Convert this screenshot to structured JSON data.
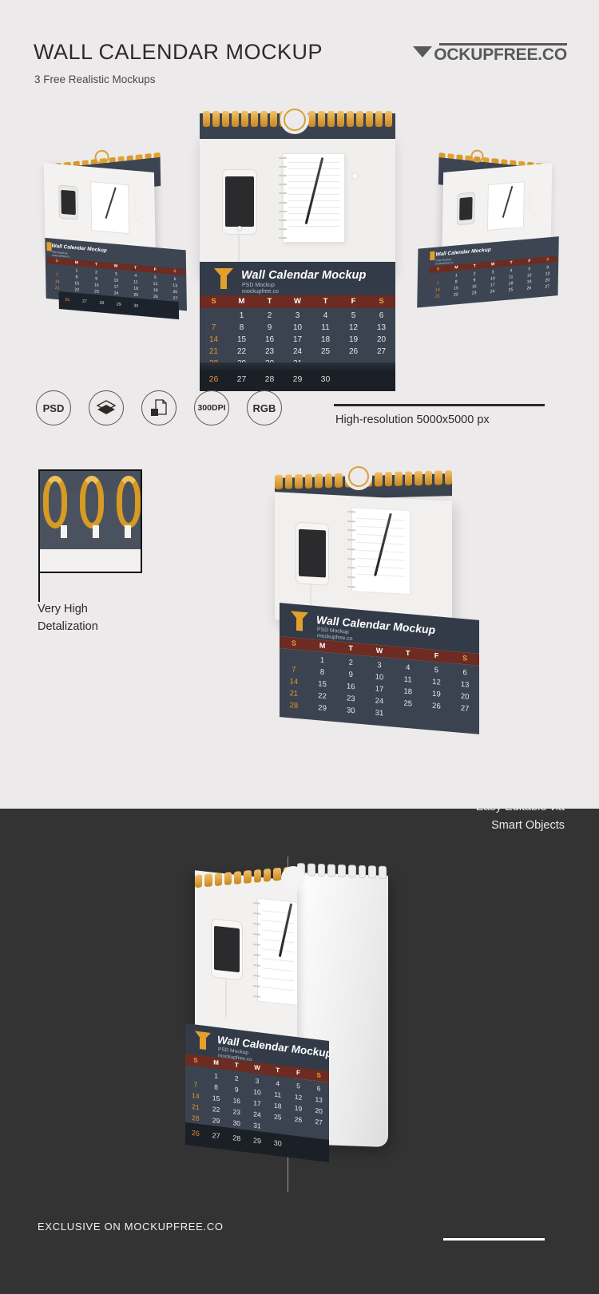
{
  "header": {
    "title": "WALL CALENDAR MOCKUP",
    "subtitle": "3 Free Realistic Mockups",
    "brand_mark": "M",
    "brand_text": "OCKUPFREE",
    "brand_suffix": ".CO"
  },
  "badges": [
    {
      "id": "psd",
      "label": "PSD",
      "icon": "psd-badge"
    },
    {
      "id": "layers",
      "label": "",
      "icon": "layers-icon"
    },
    {
      "id": "smart-object",
      "label": "",
      "icon": "smart-object-icon"
    },
    {
      "id": "dpi",
      "label_top": "300",
      "label_bottom": "DPI",
      "icon": "dpi-badge"
    },
    {
      "id": "rgb",
      "label": "RGB",
      "icon": "rgb-badge"
    }
  ],
  "resolution": {
    "text": "High-resolution 5000x5000 px"
  },
  "detail": {
    "caption_line1": "Very High",
    "caption_line2": "Detalization"
  },
  "calendar": {
    "brand_mark": "M",
    "title": "Wall Calendar Mockup",
    "sub1": "PSD Mockup",
    "sub2": "mockupfree.co",
    "weekdays": [
      "S",
      "M",
      "T",
      "W",
      "T",
      "F",
      "S"
    ],
    "weeks": [
      [
        "",
        "1",
        "2",
        "3",
        "4",
        "5",
        "6"
      ],
      [
        "7",
        "8",
        "9",
        "10",
        "11",
        "12",
        "13"
      ],
      [
        "14",
        "15",
        "16",
        "17",
        "18",
        "19",
        "20"
      ],
      [
        "21",
        "22",
        "23",
        "24",
        "25",
        "26",
        "27"
      ],
      [
        "28",
        "29",
        "30",
        "31",
        "",
        "",
        ""
      ]
    ],
    "next_row": [
      "26",
      "27",
      "28",
      "29",
      "30",
      "",
      ""
    ]
  },
  "dark_section": {
    "tagline_line1": "Easy Editable via",
    "tagline_line2": "Smart Objects",
    "footer": "EXCLUSIVE ON MOCKUPFREE.CO"
  },
  "colors": {
    "page_bg": "#eceaea",
    "dark_bg": "#333333",
    "calendar_dark": "#333b49",
    "calendar_wire": "#e3a12c",
    "grid_header": "#6d2b22",
    "sunday": "#e0962e",
    "ink": "#2b2826"
  }
}
